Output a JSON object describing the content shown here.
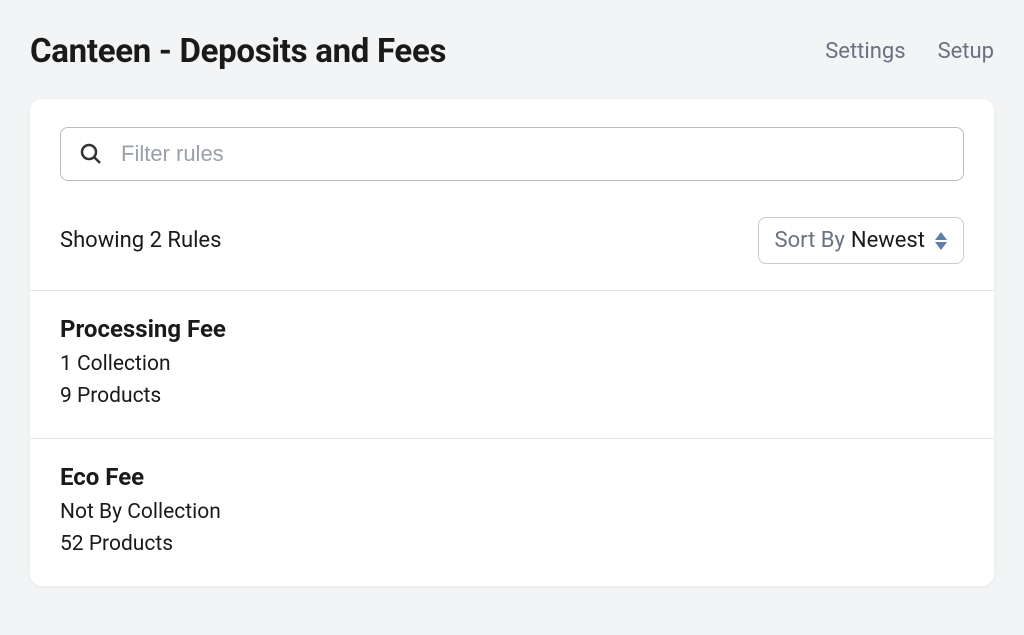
{
  "header": {
    "title": "Canteen - Deposits and Fees",
    "links": {
      "settings": "Settings",
      "setup": "Setup"
    }
  },
  "search": {
    "placeholder": "Filter rules"
  },
  "status": {
    "text": "Showing 2 Rules"
  },
  "sort": {
    "label": "Sort By",
    "value": "Newest"
  },
  "rules": [
    {
      "title": "Processing Fee",
      "line1": "1 Collection",
      "line2": "9 Products"
    },
    {
      "title": "Eco Fee",
      "line1": "Not By Collection",
      "line2": "52 Products"
    }
  ]
}
